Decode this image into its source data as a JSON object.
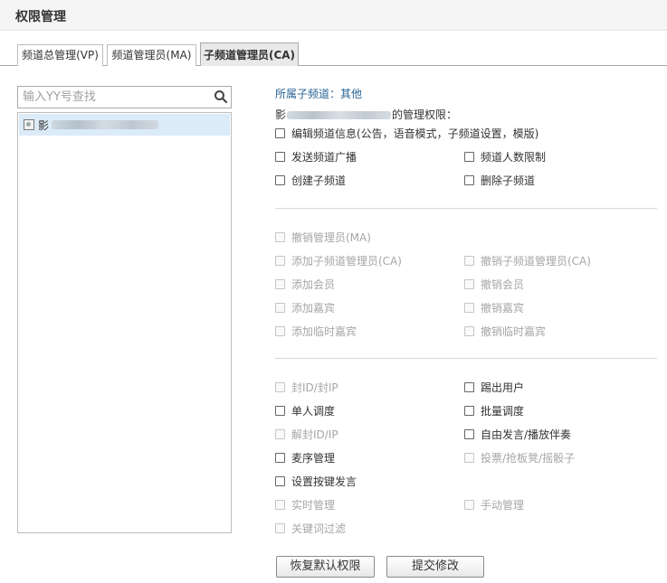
{
  "window": {
    "title": "权限管理"
  },
  "tabs": [
    {
      "label": "频道总管理(VP)",
      "active": false
    },
    {
      "label": "频道管理员(MA)",
      "active": false
    },
    {
      "label": "子频道管理员(CA)",
      "active": true
    }
  ],
  "search": {
    "placeholder": "输入YY号查找",
    "icon": "search-icon"
  },
  "member_list": [
    {
      "name_prefix": "影",
      "name_obscured": true,
      "selected": true,
      "icon": "user-icon"
    }
  ],
  "permissions": {
    "sub_channel_label": "所属子频道：其他",
    "title_prefix": "影",
    "title_suffix": "的管理权限：",
    "group1": [
      {
        "label": "编辑频道信息(公告，语音模式，子频道设置，模版)",
        "checked": false,
        "enabled": true
      },
      {
        "label": "发送频道广播",
        "checked": false,
        "enabled": true
      },
      {
        "label": "频道人数限制",
        "checked": false,
        "enabled": true
      },
      {
        "label": "创建子频道",
        "checked": false,
        "enabled": true
      },
      {
        "label": "删除子频道",
        "checked": false,
        "enabled": true
      }
    ],
    "group2": [
      {
        "label": "撤销管理员(MA)",
        "checked": false,
        "enabled": false
      },
      {
        "label": "添加子频道管理员(CA)",
        "checked": false,
        "enabled": false
      },
      {
        "label": "撤销子频道管理员(CA)",
        "checked": false,
        "enabled": false
      },
      {
        "label": "添加会员",
        "checked": false,
        "enabled": false
      },
      {
        "label": "撤销会员",
        "checked": false,
        "enabled": false
      },
      {
        "label": "添加嘉宾",
        "checked": false,
        "enabled": false
      },
      {
        "label": "撤销嘉宾",
        "checked": false,
        "enabled": false
      },
      {
        "label": "添加临时嘉宾",
        "checked": false,
        "enabled": false
      },
      {
        "label": "撤销临时嘉宾",
        "checked": false,
        "enabled": false
      }
    ],
    "group3": [
      {
        "label": "封ID/封IP",
        "checked": false,
        "enabled": false
      },
      {
        "label": "踢出用户",
        "checked": false,
        "enabled": true
      },
      {
        "label": "单人调度",
        "checked": false,
        "enabled": true
      },
      {
        "label": "批量调度",
        "checked": false,
        "enabled": true
      },
      {
        "label": "解封ID/IP",
        "checked": false,
        "enabled": false
      },
      {
        "label": "自由发言/播放伴奏",
        "checked": false,
        "enabled": true
      },
      {
        "label": "麦序管理",
        "checked": false,
        "enabled": true
      },
      {
        "label": "投票/抢板凳/摇骰子",
        "checked": false,
        "enabled": false
      },
      {
        "label": "设置按键发言",
        "checked": false,
        "enabled": true
      },
      {
        "label": "实时管理",
        "checked": false,
        "enabled": false
      },
      {
        "label": "手动管理",
        "checked": false,
        "enabled": false
      },
      {
        "label": "关键词过滤",
        "checked": false,
        "enabled": false
      }
    ]
  },
  "buttons": {
    "restore_default": "恢复默认权限",
    "submit": "提交修改"
  }
}
